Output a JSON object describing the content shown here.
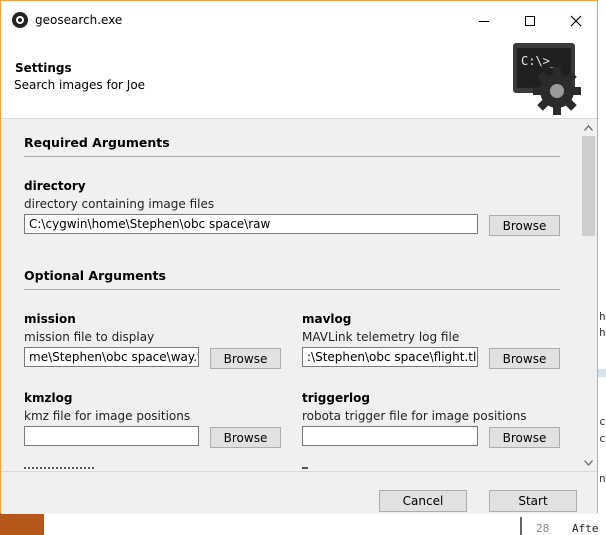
{
  "window": {
    "title": "geosearch.exe"
  },
  "header": {
    "title": "Settings",
    "subtitle": "Search images for Joe",
    "icon": "console-gear-icon"
  },
  "required": {
    "section_title": "Required Arguments",
    "directory": {
      "label": "directory",
      "description": "directory containing image files",
      "value": "C:\\cygwin\\home\\Stephen\\obc space\\raw",
      "browse": "Browse"
    }
  },
  "optional": {
    "section_title": "Optional Arguments",
    "mission": {
      "label": "mission",
      "description": "mission file to display",
      "value": "me\\Stephen\\obc space\\way.txt",
      "browse": "Browse"
    },
    "mavlog": {
      "label": "mavlog",
      "description": "MAVLink telemetry log file",
      "value": ":\\Stephen\\obc space\\flight.tlog",
      "browse": "Browse"
    },
    "kmzlog": {
      "label": "kmzlog",
      "description": "kmz file for image positions",
      "value": "",
      "browse": "Browse"
    },
    "triggerlog": {
      "label": "triggerlog",
      "description": "robota trigger file for image positions",
      "value": "",
      "browse": "Browse"
    }
  },
  "footer": {
    "cancel": "Cancel",
    "start": "Start"
  },
  "background": {
    "line_number": "28",
    "code_text": "Afte"
  }
}
